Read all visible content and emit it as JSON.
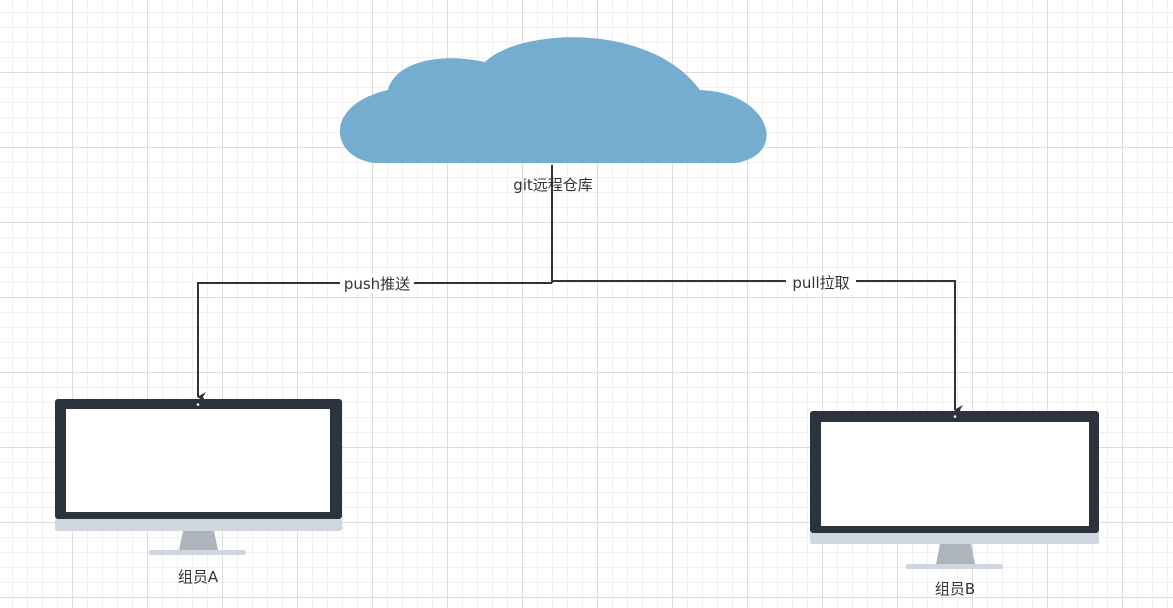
{
  "nodes": {
    "remote_repo": {
      "label": "git远程仓库",
      "icon": "cloud-icon",
      "color": "#74add0"
    },
    "member_a": {
      "label": "组员A",
      "icon": "monitor-icon"
    },
    "member_b": {
      "label": "组员B",
      "icon": "monitor-icon"
    }
  },
  "edges": {
    "push": {
      "label": "push推送",
      "from": "remote_repo",
      "to": "member_a"
    },
    "pull": {
      "label": "pull拉取",
      "from": "remote_repo",
      "to": "member_b"
    }
  },
  "colors": {
    "line": "#333333",
    "monitor_frame": "#2d333d",
    "monitor_base": "#d0d6df",
    "monitor_stand": "#aeb4bb"
  }
}
